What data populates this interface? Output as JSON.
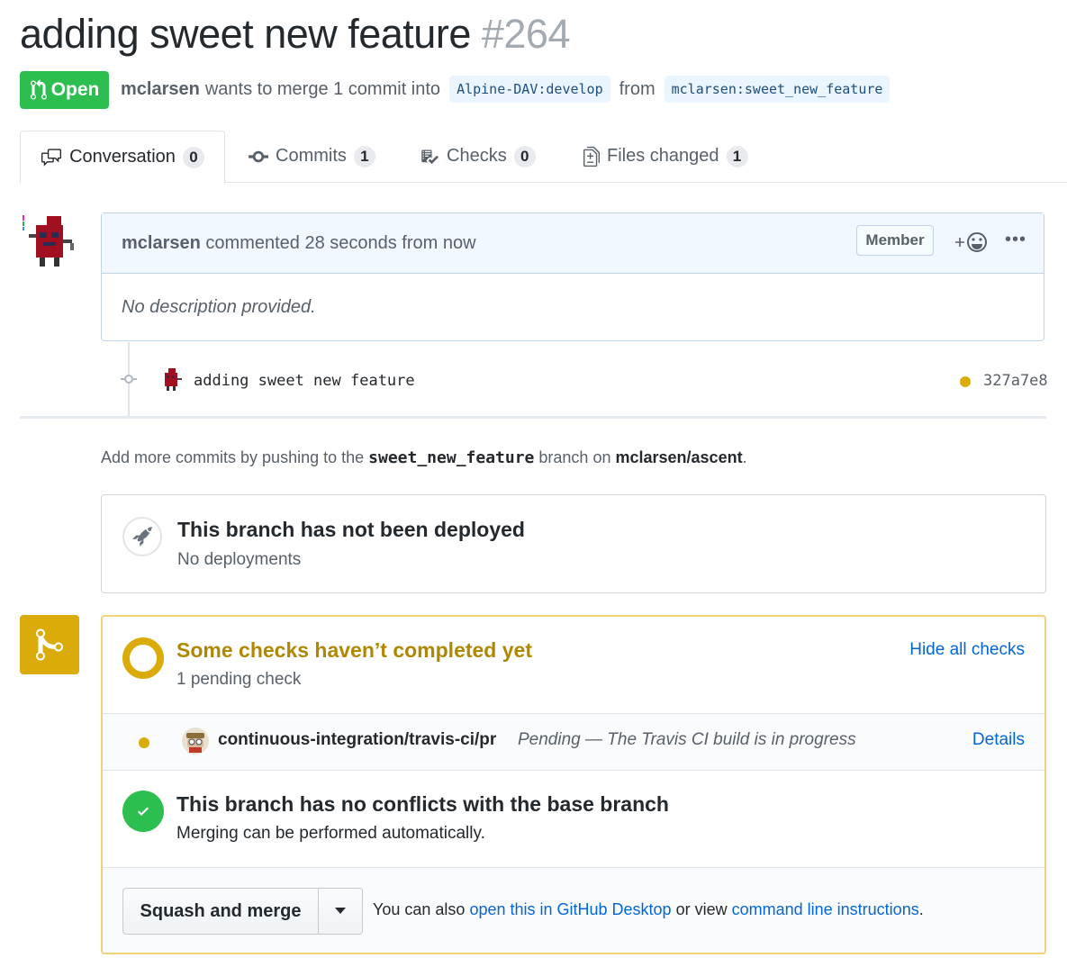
{
  "pr": {
    "title": "adding sweet new feature",
    "number": "#264",
    "state": "Open",
    "author": "mclarsen",
    "merge_text": "wants to merge 1 commit into",
    "base_branch": "Alpine-DAV:develop",
    "from_text": "from",
    "head_branch": "mclarsen:sweet_new_feature"
  },
  "tabs": [
    {
      "label": "Conversation",
      "count": "0",
      "icon": "comment-discussion-icon"
    },
    {
      "label": "Commits",
      "count": "1",
      "icon": "git-commit-icon"
    },
    {
      "label": "Checks",
      "count": "0",
      "icon": "checklist-icon"
    },
    {
      "label": "Files changed",
      "count": "1",
      "icon": "diff-icon"
    }
  ],
  "comment": {
    "author": "mclarsen",
    "action": "commented 28 seconds from now",
    "badge": "Member",
    "body": "No description provided."
  },
  "commit": {
    "message": "adding sweet new feature",
    "sha": "327a7e8",
    "status_color": "#dbab09"
  },
  "push_hint": {
    "prefix": "Add more commits by pushing to the",
    "branch": "sweet_new_feature",
    "middle": "branch on",
    "repo": "mclarsen/ascent",
    "suffix": "."
  },
  "deploy": {
    "title": "This branch has not been deployed",
    "subtitle": "No deployments"
  },
  "checks": {
    "title": "Some checks haven’t completed yet",
    "subtitle": "1 pending check",
    "toggle_label": "Hide all checks",
    "items": [
      {
        "name": "continuous-integration/travis-ci/pr",
        "description": "Pending — The Travis CI build is in progress",
        "link_label": "Details"
      }
    ]
  },
  "conflicts": {
    "title": "This branch has no conflicts with the base branch",
    "subtitle": "Merging can be performed automatically."
  },
  "merge": {
    "button_label": "Squash and merge",
    "note_prefix": "You can also",
    "desktop_link": "open this in GitHub Desktop",
    "note_middle": "or view",
    "cli_link": "command line instructions",
    "note_suffix": "."
  },
  "colors": {
    "open_green": "#2cbe4e",
    "pending_yellow": "#dbab09",
    "link_blue": "#0366d6"
  }
}
